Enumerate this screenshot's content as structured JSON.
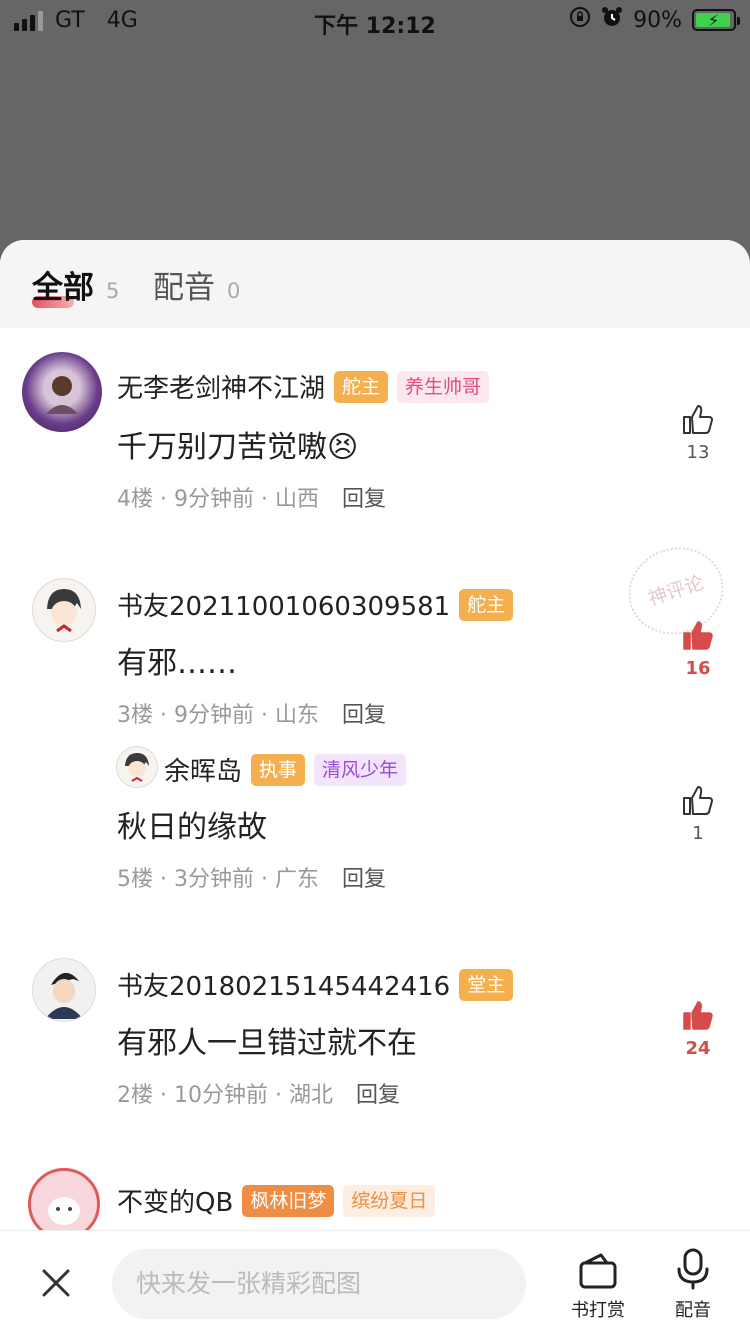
{
  "status_bar": {
    "carrier": "GT",
    "network": "4G",
    "time": "下午 12:12",
    "battery": "90%"
  },
  "tabs": [
    {
      "label": "全部",
      "count": "5"
    },
    {
      "label": "配音",
      "count": "0"
    }
  ],
  "comments": [
    {
      "name": "无李老剑神不江湖",
      "badges": [
        "舵主",
        "养生帅哥"
      ],
      "text": "千万别刀苦觉嗷",
      "emoji": "😣",
      "meta": "4楼 · 9分钟前 · 山西",
      "reply": "回复",
      "likes": "13",
      "liked": false
    },
    {
      "name": "书友20211001060309581",
      "badges": [
        "舵主"
      ],
      "text": "有邪……",
      "meta": "3楼 · 9分钟前 · 山东",
      "reply": "回复",
      "likes": "16",
      "liked": true
    },
    {
      "name": "余晖岛",
      "badges": [
        "执事",
        "清风少年"
      ],
      "text": "秋日的缘故",
      "meta": "5楼 · 3分钟前 · 广东",
      "reply": "回复",
      "likes": "1",
      "liked": false
    },
    {
      "name": "书友20180215145442416",
      "badges": [
        "堂主"
      ],
      "text": "有邪人一旦错过就不在",
      "meta": "2楼 · 10分钟前 · 湖北",
      "reply": "回复",
      "likes": "24",
      "liked": true
    },
    {
      "name": "不变的QB",
      "badges": [
        "枫林旧梦",
        "缤纷夏日"
      ]
    }
  ],
  "stamp": "神评论",
  "bottom_bar": {
    "placeholder": "快来发一张精彩配图",
    "reward_label": "书打赏",
    "voice_label": "配音"
  },
  "colors": {
    "accent_red": "#d84b4b",
    "badge_orange": "#f4b04f",
    "badge_pink": "#e04c83",
    "badge_purple": "#9c4bd6"
  },
  "icons": [
    "signal-icon",
    "alarm-icon",
    "rotation-lock-icon",
    "battery-icon",
    "thumb-up-icon",
    "close-icon",
    "wallet-icon",
    "microphone-icon"
  ]
}
